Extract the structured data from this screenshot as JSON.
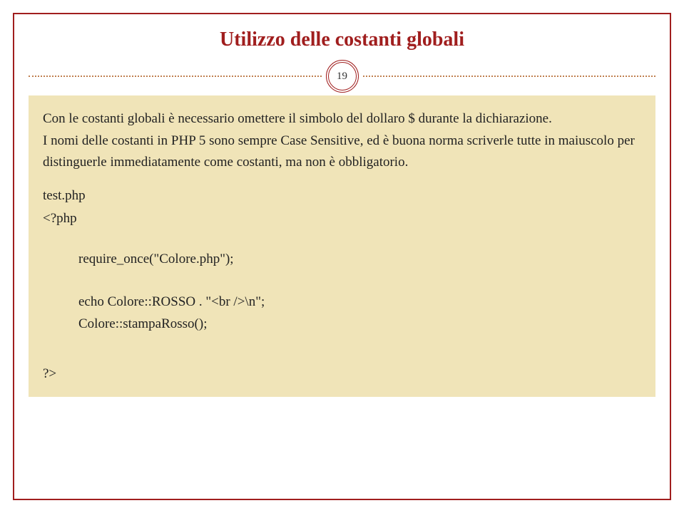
{
  "title": "Utilizzo delle costanti globali",
  "pageNumber": "19",
  "body": {
    "p1": "Con le costanti globali è necessario omettere il simbolo del dollaro $ durante la dichiarazione.",
    "p2": "I nomi delle costanti in PHP 5 sono sempre Case Sensitive, ed è buona norma scriverle tutte in maiuscolo per distinguerle immediatamente come costanti, ma non è obbligatorio.",
    "fileLabel": "test.php",
    "openTag": "<?php",
    "code1": "require_once(\"Colore.php\");",
    "code2": "echo Colore::ROSSO . \"<br />\\n\";",
    "code3": "Colore::stampaRosso();",
    "closeTag": "?>"
  }
}
